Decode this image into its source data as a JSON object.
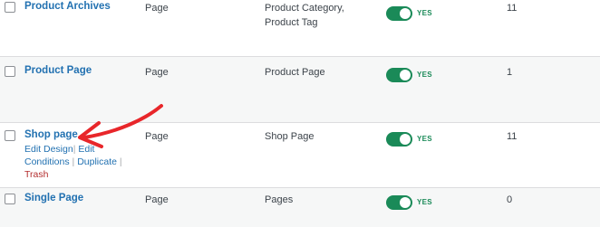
{
  "rows": [
    {
      "title": "Product Archives",
      "type": "Page",
      "conditions_line1": "Product Category,",
      "conditions_line2": "Product Tag",
      "status": "YES",
      "count": "11"
    },
    {
      "title": "Product Page",
      "type": "Page",
      "conditions_line1": "Product Page",
      "status": "YES",
      "count": "1"
    },
    {
      "title": "Shop page",
      "type": "Page",
      "conditions_line1": "Shop Page",
      "status": "YES",
      "count": "11",
      "actions": {
        "edit_design": "Edit Design",
        "edit": "Edit",
        "conditions": "Conditions",
        "duplicate": "Duplicate",
        "trash": "Trash",
        "sep": "|"
      }
    },
    {
      "title": "Single Page",
      "type": "Page",
      "conditions_line1": "Pages",
      "status": "YES",
      "count": "0"
    }
  ],
  "colors": {
    "toggle_on": "#1a8a58",
    "link": "#2271b1",
    "trash": "#b32d2e",
    "arrow": "#e8262a",
    "row_alt": "#f6f7f7"
  },
  "annotation": {
    "icon": "red-arrow-icon"
  }
}
